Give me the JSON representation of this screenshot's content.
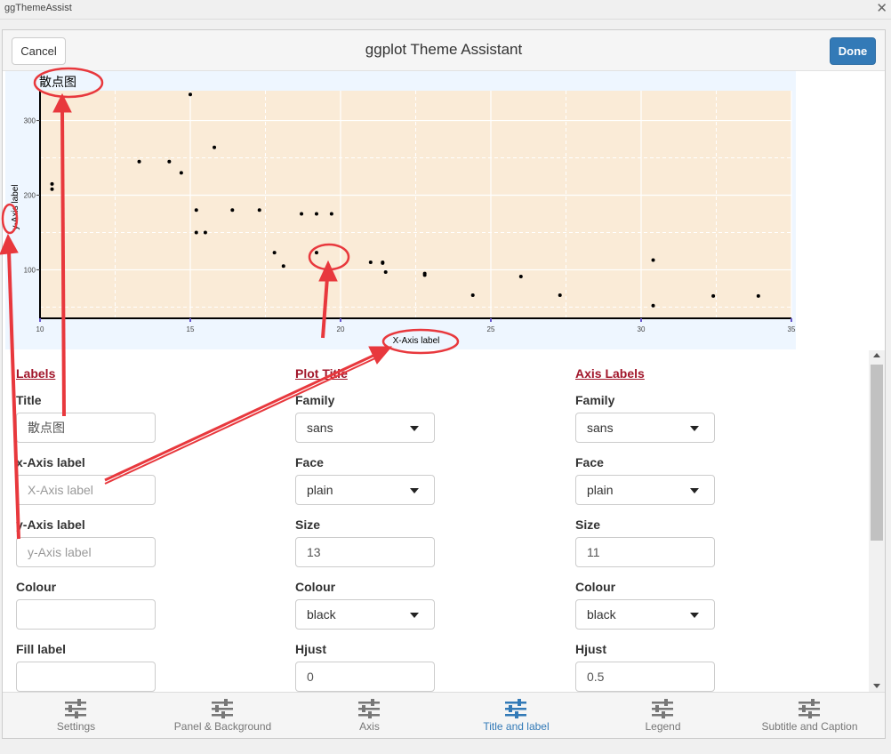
{
  "window": {
    "title": "ggThemeAssist",
    "close_glyph": "✕"
  },
  "gadget": {
    "title": "ggplot Theme Assistant",
    "cancel_label": "Cancel",
    "done_label": "Done"
  },
  "chart_data": {
    "type": "scatter",
    "title": "散点图",
    "xlabel": "X-Axis label",
    "ylabel": "y-Axis label",
    "xlim": [
      10,
      35
    ],
    "ylim": [
      35,
      340
    ],
    "xticks": [
      10,
      15,
      20,
      25,
      30,
      35
    ],
    "yticks": [
      100,
      200,
      300
    ],
    "grid": true,
    "background": "#faebd7",
    "point_color": "#000000",
    "points": [
      [
        10.4,
        215
      ],
      [
        10.4,
        208
      ],
      [
        13.3,
        245
      ],
      [
        14.3,
        245
      ],
      [
        14.7,
        230
      ],
      [
        15.0,
        335
      ],
      [
        15.2,
        180
      ],
      [
        15.2,
        150
      ],
      [
        15.5,
        150
      ],
      [
        15.8,
        264
      ],
      [
        16.4,
        180
      ],
      [
        17.3,
        180
      ],
      [
        17.8,
        123
      ],
      [
        18.1,
        105
      ],
      [
        18.7,
        175
      ],
      [
        19.2,
        175
      ],
      [
        19.2,
        123
      ],
      [
        19.7,
        175
      ],
      [
        21.0,
        110
      ],
      [
        21.4,
        110
      ],
      [
        21.4,
        109
      ],
      [
        21.5,
        97
      ],
      [
        22.8,
        95
      ],
      [
        22.8,
        93
      ],
      [
        24.4,
        66
      ],
      [
        26.0,
        91
      ],
      [
        27.3,
        66
      ],
      [
        30.4,
        113
      ],
      [
        30.4,
        52
      ],
      [
        32.4,
        65
      ],
      [
        33.9,
        65
      ]
    ]
  },
  "labels_column": {
    "heading": "Labels",
    "fields": [
      {
        "label": "Title",
        "value": "散点图",
        "placeholder": ""
      },
      {
        "label": "x-Axis label",
        "value": "",
        "placeholder": "X-Axis label"
      },
      {
        "label": "y-Axis label",
        "value": "",
        "placeholder": "y-Axis label"
      },
      {
        "label": "Colour",
        "value": "",
        "placeholder": ""
      },
      {
        "label": "Fill label",
        "value": "",
        "placeholder": ""
      }
    ]
  },
  "plot_title_column": {
    "heading": "Plot Title",
    "family_label": "Family",
    "family_value": "sans",
    "face_label": "Face",
    "face_value": "plain",
    "size_label": "Size",
    "size_value": "13",
    "colour_label": "Colour",
    "colour_value": "black",
    "hjust_label": "Hjust",
    "hjust_value": "0"
  },
  "axis_labels_column": {
    "heading": "Axis Labels",
    "family_label": "Family",
    "family_value": "sans",
    "face_label": "Face",
    "face_value": "plain",
    "size_label": "Size",
    "size_value": "11",
    "colour_label": "Colour",
    "colour_value": "black",
    "hjust_label": "Hjust",
    "hjust_value": "0.5"
  },
  "bottom_nav": {
    "active": "Title and label",
    "items": [
      {
        "label": "Settings",
        "icon": "sliders-icon"
      },
      {
        "label": "Panel & Background",
        "icon": "sliders-icon"
      },
      {
        "label": "Axis",
        "icon": "sliders-icon"
      },
      {
        "label": "Title and label",
        "icon": "sliders-icon"
      },
      {
        "label": "Legend",
        "icon": "sliders-icon"
      },
      {
        "label": "Subtitle and Caption",
        "icon": "sliders-icon"
      }
    ]
  },
  "colors": {
    "accent": "#337ab7",
    "heading": "#a1162a",
    "annotation": "#e8383d",
    "panel_bg": "#faebd7"
  }
}
